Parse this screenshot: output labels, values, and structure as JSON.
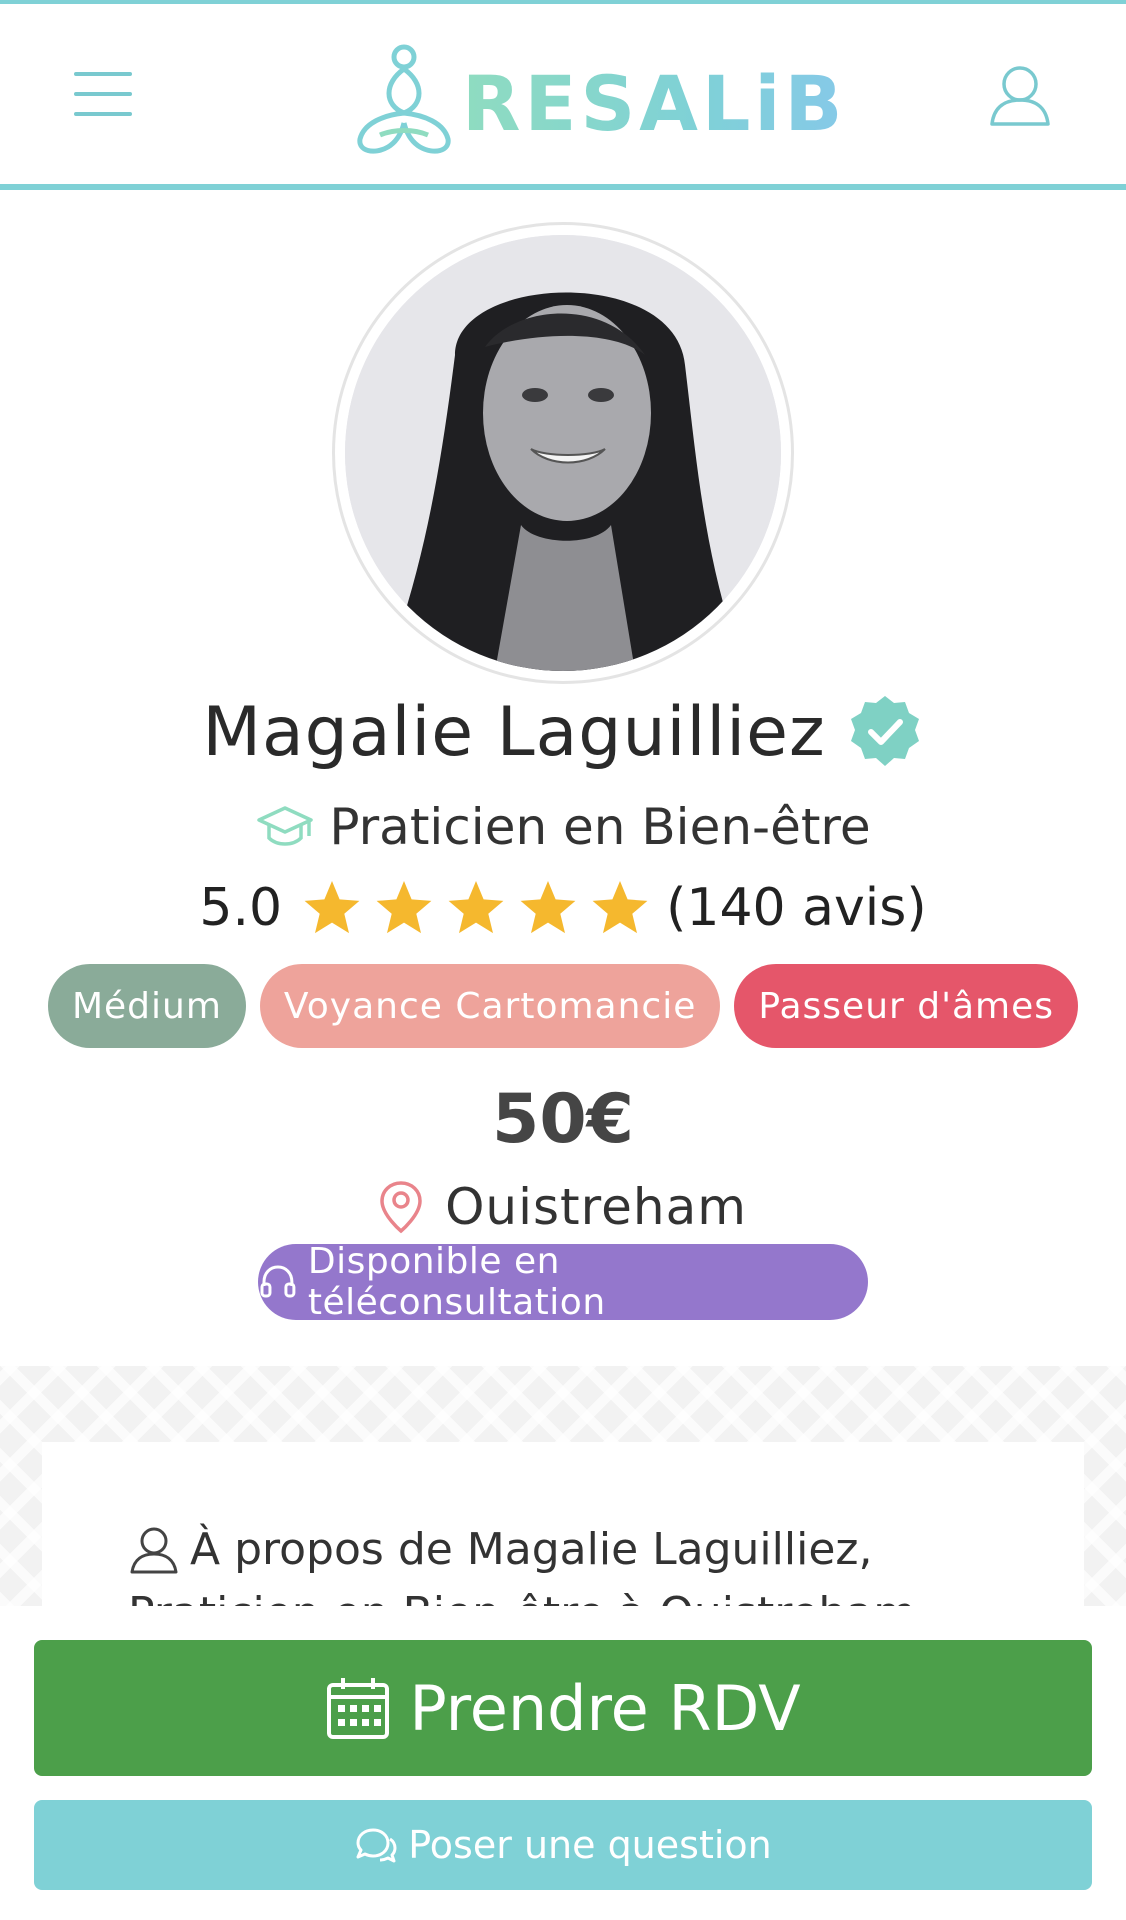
{
  "header": {
    "logo_text": "RESALiB",
    "menu_icon": "hamburger-menu-icon",
    "account_icon": "user-icon"
  },
  "profile": {
    "name": "Magalie Laguilliez",
    "verified": true,
    "role": "Praticien en Bien-être",
    "rating_value": "5.0",
    "stars": 5,
    "reviews": "(140 avis)",
    "tags": [
      {
        "label": "Médium",
        "color": "#8aab99"
      },
      {
        "label": "Voyance Cartomancie",
        "color": "#eea39b"
      },
      {
        "label": "Passeur d'âmes",
        "color": "#e5566a"
      }
    ],
    "price": "50€",
    "city": "Ouistreham",
    "teleconsultation": "Disponible en téléconsultation"
  },
  "about": {
    "title": "À propos de Magalie Laguilliez,",
    "subtitle": "Praticien en Bien-être à Ouistreham"
  },
  "actions": {
    "book_label": "Prendre RDV",
    "question_label": "Poser une question"
  },
  "colors": {
    "brand": "#7fd1d6",
    "book": "#4c9f4a",
    "teleconsultation": "#9477cc",
    "star": "#f5b82e"
  }
}
